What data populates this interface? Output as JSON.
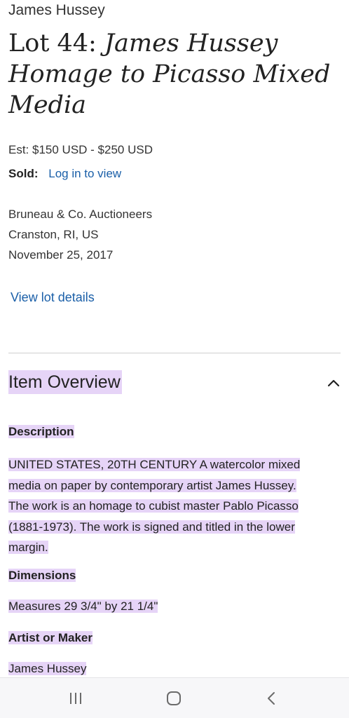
{
  "header": {
    "artist": "James Hussey",
    "lot_number": "Lot 44:",
    "lot_title": "James Hussey Homage to Picasso Mixed Media"
  },
  "pricing": {
    "estimate": "Est: $150 USD - $250 USD",
    "sold_label": "Sold:",
    "sold_link": "Log in to view"
  },
  "auction": {
    "house": "Bruneau & Co. Auctioneers",
    "location": "Cranston, RI, US",
    "date": "November 25, 2017"
  },
  "links": {
    "view_lot_details": "View lot details"
  },
  "overview": {
    "title": "Item Overview",
    "expanded": true,
    "sections": {
      "description": {
        "label": "Description",
        "lines": [
          "UNITED STATES, 20TH CENTURY A watercolor mixed",
          "media on paper by contemporary artist James Hussey.",
          "The work is an homage to cubist master Pablo Picasso",
          "(1881-1973). The work is signed and titled in the lower",
          "margin."
        ]
      },
      "dimensions": {
        "label": "Dimensions",
        "value": "Measures 29 3/4\" by 21 1/4\""
      },
      "artist": {
        "label": "Artist or Maker",
        "value": "James Hussey"
      }
    }
  },
  "colors": {
    "link": "#1a5fa8",
    "highlight": "#e6d4f7",
    "nav_bg": "#f7f7f9"
  },
  "navbar": {
    "icons": [
      "recents-icon",
      "home-icon",
      "back-icon"
    ]
  }
}
